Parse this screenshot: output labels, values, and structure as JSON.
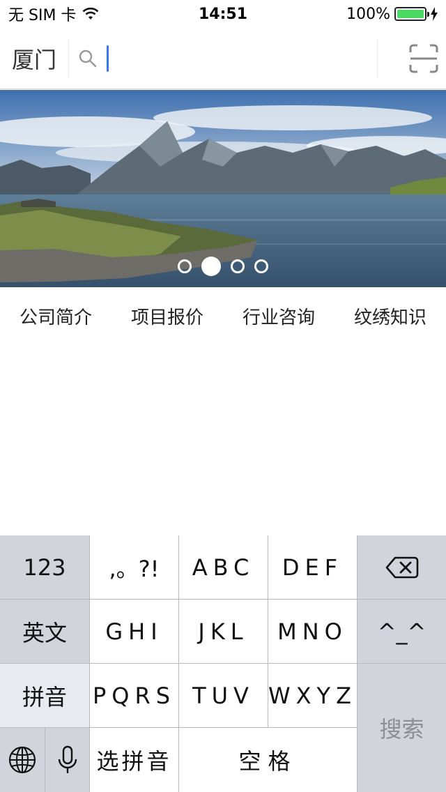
{
  "status_bar": {
    "carrier": "无 SIM 卡",
    "time": "14:51",
    "battery": "100%",
    "battery_level": 1.0,
    "icons": [
      "wifi-icon",
      "battery-icon",
      "charging-icon"
    ]
  },
  "header": {
    "city": "厦门",
    "search": {
      "value": "",
      "icon": "search-icon"
    },
    "scan_icon": "scan-icon"
  },
  "banner": {
    "page_count": 4,
    "active_page": 2
  },
  "categories": [
    {
      "label": "公司简介"
    },
    {
      "label": "项目报价"
    },
    {
      "label": "行业咨询"
    },
    {
      "label": "纹绣知识"
    }
  ],
  "keyboard": {
    "row1": {
      "numbers": "123",
      "punct": ",。?!",
      "abc": "ABC",
      "def": "DEF",
      "delete_icon": "backspace-icon"
    },
    "row2": {
      "english": "英文",
      "ghi": "GHI",
      "jkl": "JKL",
      "mno": "MNO",
      "emoticon": "^_^"
    },
    "row3": {
      "pinyin": "拼音",
      "pqrs": "PQRS",
      "tuv": "TUV",
      "wxyz": "WXYZ"
    },
    "row4": {
      "globe_icon": "globe-icon",
      "mic_icon": "microphone-icon",
      "select_pinyin": "选拼音",
      "space": "空格"
    },
    "search": "搜索"
  },
  "colors": {
    "caret": "#3478f6",
    "battery": "#4cd964",
    "keyboard_bg": "#d1d4db"
  }
}
